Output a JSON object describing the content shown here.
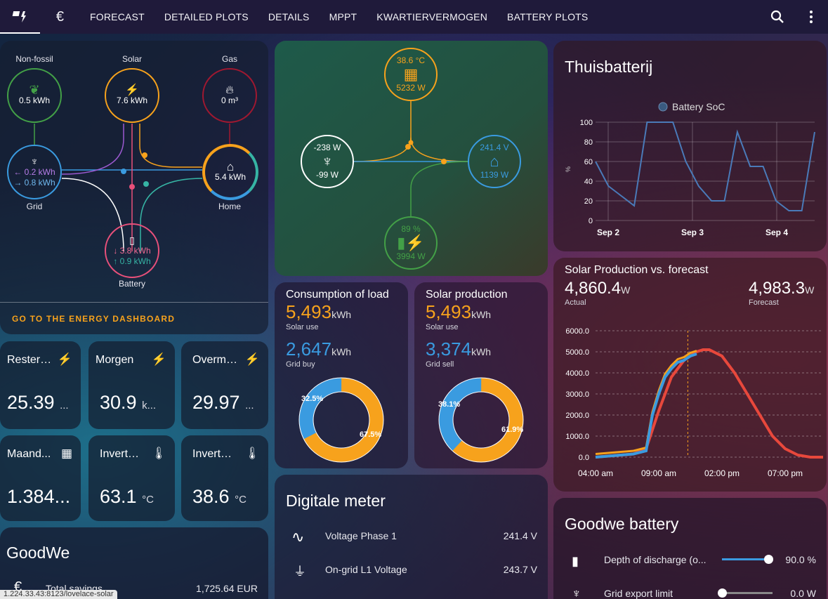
{
  "topbar": {
    "tabs": [
      "FORECAST",
      "DETAILED PLOTS",
      "DETAILS",
      "MPPT",
      "KWARTIERVERMOGEN",
      "BATTERY PLOTS"
    ]
  },
  "flow": {
    "nonfossil": {
      "label": "Non-fossil",
      "value": "0.5 kWh"
    },
    "solar": {
      "label": "Solar",
      "value": "7.6 kWh"
    },
    "gas": {
      "label": "Gas",
      "value": "0 m³"
    },
    "grid": {
      "label": "Grid",
      "in": "0.2 kWh",
      "out": "0.8 kWh"
    },
    "home": {
      "label": "Home",
      "value": "5.4 kWh"
    },
    "battery": {
      "label": "Battery",
      "in": "3.8 kWh",
      "out": "0.9 kWh"
    },
    "link": "GO TO THE ENERGY DASHBOARD"
  },
  "power": {
    "solar_temp": "38.6 °C",
    "solar_w": "5232 W",
    "grid_in": "-238 W",
    "grid_out": "-99 W",
    "home_v": "241.4 V",
    "home_w": "1139 W",
    "battery_pct": "89 %",
    "battery_w": "3994 W"
  },
  "tiles": [
    {
      "name": "Restere...",
      "value": "25.39",
      "unit": "..."
    },
    {
      "name": "Morgen",
      "value": "30.9",
      "unit": "k..."
    },
    {
      "name": "Overmo...",
      "value": "29.97",
      "unit": "..."
    },
    {
      "name": "Maand...",
      "value": "1.384...",
      "unit": ""
    },
    {
      "name": "Inverter...",
      "value": "63.1",
      "unit": "°C"
    },
    {
      "name": "Inverter...",
      "value": "38.6",
      "unit": "°C"
    }
  ],
  "goodwe": {
    "title": "GoodWe",
    "row_label": "Total savings",
    "row_value": "1,725.64 EUR"
  },
  "url": "1.224.33.43:8123/lovelace-solar",
  "load": {
    "title": "Consumption of load",
    "solar_use": "5,493",
    "solar_use_unit": "kWh",
    "solar_use_lbl": "Solar use",
    "grid": "2,647",
    "grid_unit": "kWh",
    "grid_lbl": "Grid buy",
    "pct_blue": "32.5%",
    "pct_orange": "67.5%",
    "frac_blue": 0.325
  },
  "solarprod": {
    "title": "Solar production",
    "solar_use": "5,493",
    "solar_use_unit": "kWh",
    "solar_use_lbl": "Solar use",
    "grid": "3,374",
    "grid_unit": "kWh",
    "grid_lbl": "Grid sell",
    "pct_blue": "38.1%",
    "pct_orange": "61.9%",
    "frac_blue": 0.381
  },
  "meter": {
    "title": "Digitale meter",
    "rows": [
      {
        "label": "Voltage Phase 1",
        "value": "241.4 V"
      },
      {
        "label": "On-grid L1 Voltage",
        "value": "243.7 V"
      }
    ]
  },
  "thuis": {
    "title": "Thuisbatterij",
    "legend": "Battery SoC",
    "ylabel": "%"
  },
  "solarfc": {
    "title": "Solar Production vs. forecast",
    "actual": "4,860.4",
    "actual_unit": "W",
    "actual_lbl": "Actual",
    "forecast": "4,983.3",
    "forecast_unit": "W",
    "forecast_lbl": "Forecast"
  },
  "gbatt": {
    "title": "Goodwe battery",
    "rows": [
      {
        "label": "Depth of discharge (o...",
        "value": "90.0 %",
        "level": 0.9
      },
      {
        "label": "Grid export limit",
        "value": "0.0 W",
        "level": 0
      }
    ]
  },
  "colors": {
    "orange": "#f7a21c",
    "blue": "#3a9be0",
    "red": "#e8483c",
    "green": "#43a047",
    "pink": "#e8507a",
    "purple": "#9b59d0",
    "teal": "#36b4a4"
  },
  "chart_data": [
    {
      "type": "line",
      "title": "",
      "series": [
        {
          "name": "Battery SoC",
          "x": [
            "Sep 2 00:00",
            "Sep 2 04:00",
            "Sep 2 08:00",
            "Sep 2 10:00",
            "Sep 2 12:00",
            "Sep 2 16:00",
            "Sep 2 20:00",
            "Sep 3 00:00",
            "Sep 3 04:00",
            "Sep 3 08:00",
            "Sep 3 10:00",
            "Sep 3 12:00",
            "Sep 3 16:00",
            "Sep 3 20:00",
            "Sep 4 00:00",
            "Sep 4 04:00",
            "Sep 4 08:00",
            "Sep 4 12:00"
          ],
          "values": [
            60,
            35,
            25,
            15,
            100,
            100,
            100,
            60,
            35,
            20,
            20,
            90,
            55,
            55,
            20,
            10,
            10,
            90
          ]
        }
      ],
      "x_ticks": [
        "Sep 2",
        "Sep 3",
        "Sep 4"
      ],
      "y_ticks": [
        0,
        20,
        40,
        60,
        80,
        100
      ],
      "ylim": [
        0,
        100
      ],
      "ylabel": "%"
    },
    {
      "type": "line",
      "title": "Solar Production vs. forecast",
      "x_ticks": [
        "04:00 am",
        "09:00 am",
        "02:00 pm",
        "07:00 pm"
      ],
      "y_ticks": [
        "0.0",
        "1000.0",
        "2000.0",
        "3000.0",
        "4000.0",
        "5000.0",
        "6000.0"
      ],
      "ylim": [
        0,
        6000
      ],
      "series": [
        {
          "name": "Actual",
          "x": [
            4,
            5,
            6,
            7,
            8,
            8.5,
            9,
            9.5,
            10,
            10.5,
            11,
            11.5,
            12
          ],
          "values": [
            0,
            50,
            100,
            150,
            300,
            2000,
            3000,
            3800,
            4200,
            4500,
            4600,
            4800,
            4900
          ]
        },
        {
          "name": "Forecast",
          "x": [
            4,
            5,
            6,
            7,
            8,
            9,
            10,
            11,
            12,
            12.5,
            13,
            14,
            15,
            16,
            17,
            18,
            19,
            20,
            21,
            22
          ],
          "values": [
            0,
            50,
            100,
            150,
            400,
            2200,
            3800,
            4600,
            5000,
            5100,
            5100,
            4800,
            4000,
            3000,
            2000,
            1000,
            400,
            100,
            0,
            0
          ]
        }
      ]
    }
  ]
}
